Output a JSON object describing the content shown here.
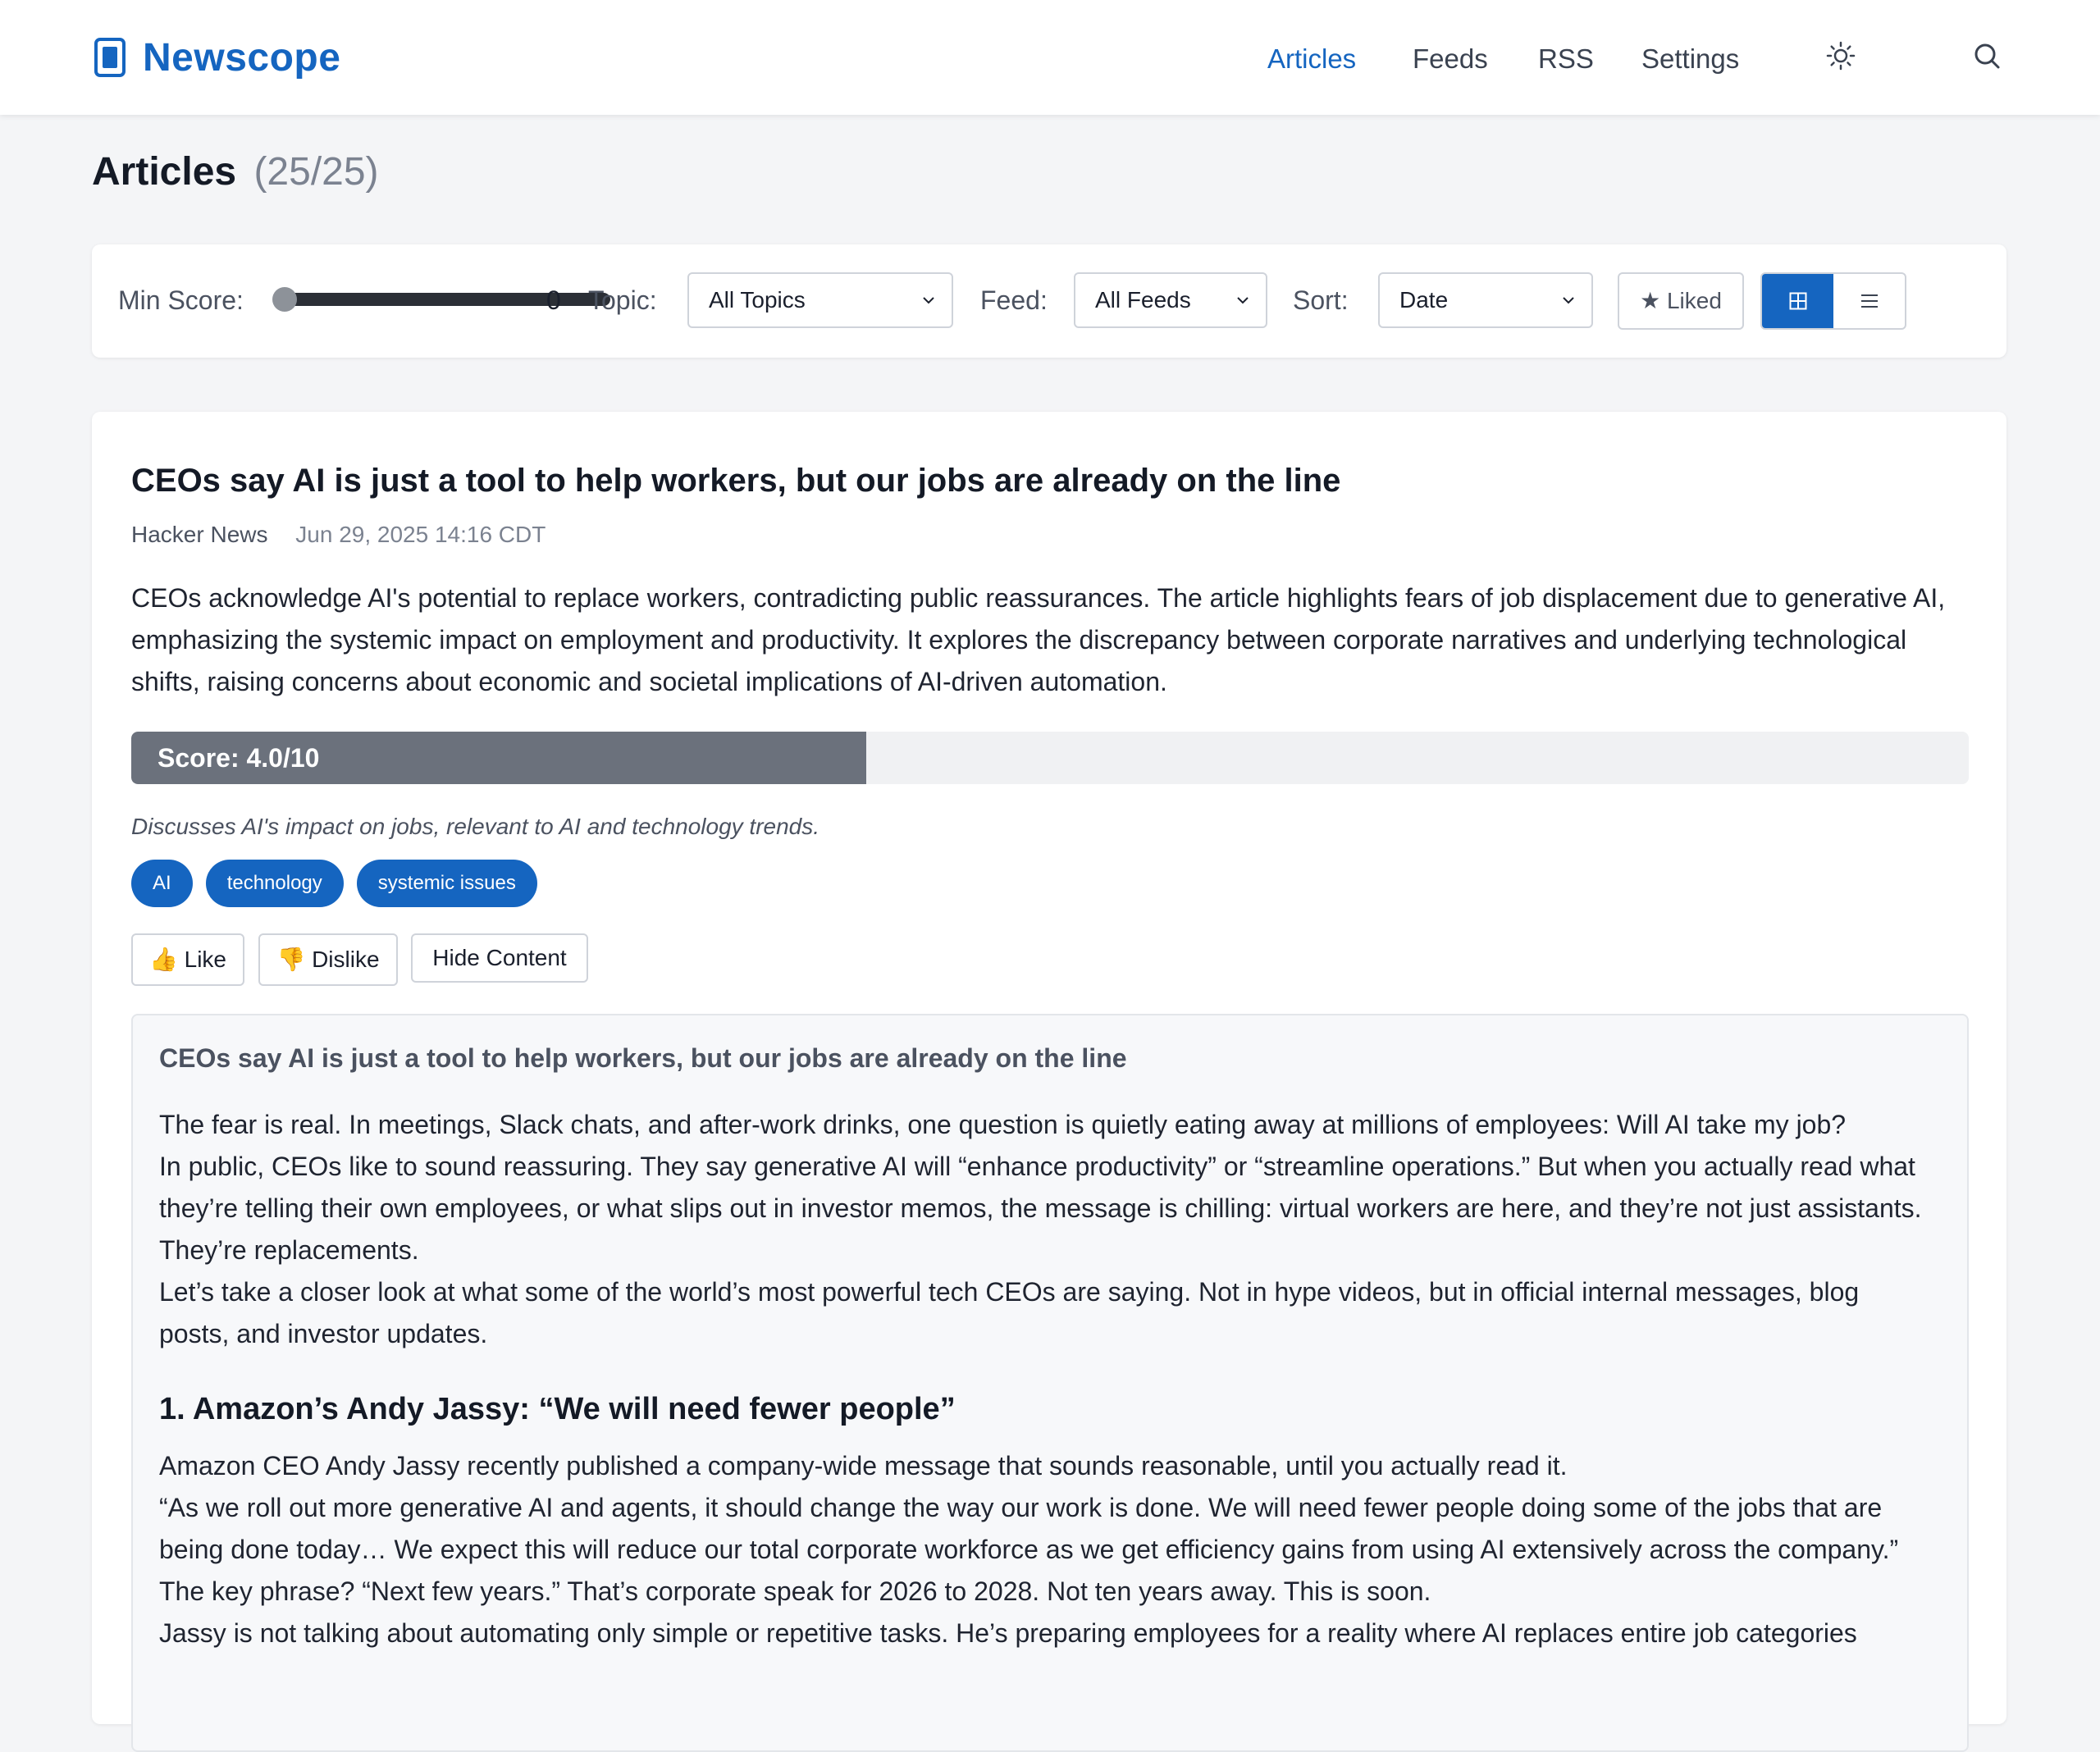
{
  "header": {
    "brand": "Newscope",
    "nav": [
      {
        "label": "Articles",
        "active": true
      },
      {
        "label": "Feeds",
        "active": false
      },
      {
        "label": "RSS",
        "active": false
      },
      {
        "label": "Settings",
        "active": false
      }
    ],
    "icons": [
      "sun-icon",
      "search-icon"
    ]
  },
  "page": {
    "title": "Articles",
    "count": "(25/25)"
  },
  "filters": {
    "min_score_label": "Min Score:",
    "min_score_value": "0",
    "topic_label": "Topic:",
    "topic_selected": "All Topics",
    "feed_label": "Feed:",
    "feed_selected": "All Feeds",
    "sort_label": "Sort:",
    "sort_selected": "Date",
    "liked_label": "★ Liked",
    "view_modes": [
      "grid-view-icon",
      "list-view-icon"
    ],
    "active_view": "grid"
  },
  "article": {
    "title": "CEOs say AI is just a tool to help workers, but our jobs are already on the line",
    "source": "Hacker News",
    "date": "Jun 29, 2025 14:16 CDT",
    "summary": "CEOs acknowledge AI's potential to replace workers, contradicting public reassurances. The article highlights fears of job displacement due to generative AI, emphasizing the systemic impact on employment and productivity. It explores the discrepancy between corporate narratives and underlying technological shifts, raising concerns about economic and societal implications of AI-driven automation.",
    "score_text": "Score: 4.0/10",
    "score_value": 4.0,
    "score_max": 10,
    "reason": "Discusses AI's impact on jobs, relevant to AI and technology trends.",
    "tags": [
      "AI",
      "technology",
      "systemic issues"
    ],
    "like_label": "👍 Like",
    "dislike_label": "👎 Dislike",
    "hide_label": "Hide Content",
    "content": {
      "title": "CEOs say AI is just a tool to help workers, but our jobs are already on the line",
      "paragraphs_1": [
        "The fear is real. In meetings, Slack chats, and after-work drinks, one question is quietly eating away at millions of employees: Will AI take my job?",
        "In public, CEOs like to sound reassuring. They say generative AI will “enhance productivity” or “streamline operations.” But when you actually read what they’re telling their own employees, or what slips out in investor memos, the message is chilling: virtual workers are here, and they’re not just assistants. They’re replacements.",
        "Let’s take a closer look at what some of the world’s most powerful tech CEOs are saying. Not in hype videos, but in official internal messages, blog posts, and investor updates."
      ],
      "heading_1": "1. Amazon’s Andy Jassy: “We will need fewer people”",
      "paragraphs_2": [
        "Amazon CEO Andy Jassy recently published a company-wide message that sounds reasonable, until you actually read it.",
        "“As we roll out more generative AI and agents, it should change the way our work is done. We will need fewer people doing some of the jobs that are being done today… We expect this will reduce our total corporate workforce as we get efficiency gains from using AI extensively across the company.”",
        "The key phrase? “Next few years.” That’s corporate speak for 2026 to 2028. Not ten years away. This is soon.",
        "Jassy is not talking about automating only simple or repetitive tasks. He’s preparing employees for a reality where AI replaces entire job categories"
      ]
    }
  },
  "colors": {
    "brand": "#1565c0",
    "score_fill": "#6b717c",
    "page_bg": "#f4f5f7"
  }
}
